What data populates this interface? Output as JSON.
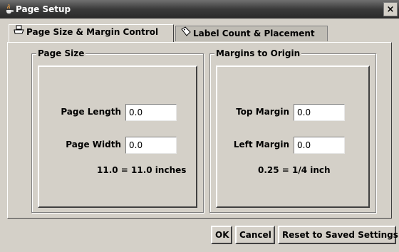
{
  "window": {
    "title": "Page Setup",
    "close_glyph": "×",
    "app_icon": "java-cup-icon"
  },
  "tabs": [
    {
      "label": "Page Size & Margin Control",
      "icon": "printer-icon",
      "active": true
    },
    {
      "label": "Label Count & Placement",
      "icon": "label-icon",
      "active": false
    }
  ],
  "page_size": {
    "legend": "Page Size",
    "length_label": "Page Length",
    "length_value": "0.0",
    "width_label": "Page Width",
    "width_value": "0.0",
    "note": "11.0 = 11.0 inches"
  },
  "margins": {
    "legend": "Margins to Origin",
    "top_label": "Top Margin",
    "top_value": "0.0",
    "left_label": "Left Margin",
    "left_value": "0.0",
    "note": "0.25 = 1/4 inch"
  },
  "buttons": {
    "ok": "OK",
    "cancel": "Cancel",
    "reset": "Reset to Saved Settings"
  }
}
